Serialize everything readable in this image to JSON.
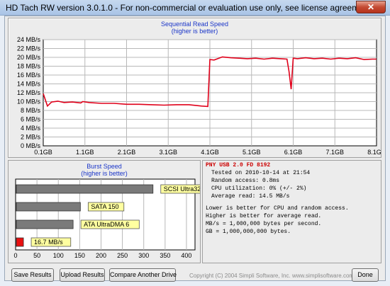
{
  "window": {
    "title": "HD Tach RW version 3.0.1.0  - For non-commercial or evaluation use only, see license agreement.",
    "close_label": "✕"
  },
  "read_chart": {
    "title": "Sequential Read Speed",
    "subtitle": "(higher is better)",
    "y_ticks": [
      "0 MB/s",
      "2 MB/s",
      "4 MB/s",
      "6 MB/s",
      "8 MB/s",
      "10 MB/s",
      "12 MB/s",
      "14 MB/s",
      "16 MB/s",
      "18 MB/s",
      "20 MB/s",
      "22 MB/s",
      "24 MB/s"
    ],
    "x_ticks": [
      "0.1GB",
      "1.1GB",
      "2.1GB",
      "3.1GB",
      "4.1GB",
      "5.1GB",
      "6.1GB",
      "7.1GB",
      "8.1GB"
    ],
    "line_color": "#e0001a"
  },
  "burst_chart": {
    "title": "Burst Speed",
    "subtitle": "(higher is better)",
    "x_ticks": [
      "0",
      "50",
      "100",
      "150",
      "200",
      "250",
      "300",
      "350",
      "400"
    ]
  },
  "chart_data": [
    {
      "type": "line",
      "title": "Sequential Read Speed",
      "subtitle": "(higher is better)",
      "xlabel": "",
      "ylabel": "",
      "x_unit": "GB",
      "y_unit": "MB/s",
      "xlim": [
        0.1,
        8.1
      ],
      "ylim": [
        0,
        24
      ],
      "grid": true,
      "series": [
        {
          "x": [
            0.1,
            0.2,
            0.3,
            0.45,
            0.6,
            0.8,
            1.0,
            1.05,
            1.2,
            1.5,
            1.8,
            2.1,
            2.4,
            2.7,
            3.0,
            3.3,
            3.6,
            3.9,
            4.05,
            4.1,
            4.2,
            4.4,
            4.6,
            4.8,
            5.0,
            5.2,
            5.4,
            5.6,
            5.8,
            5.95,
            6.0,
            6.05,
            6.1,
            6.2,
            6.4,
            6.6,
            6.8,
            7.0,
            7.2,
            7.4,
            7.6,
            7.8,
            8.0,
            8.1
          ],
          "y": [
            11.8,
            9.0,
            9.9,
            10.1,
            9.8,
            9.9,
            9.7,
            10.0,
            9.8,
            9.6,
            9.6,
            9.4,
            9.4,
            9.3,
            9.2,
            9.3,
            9.3,
            9.0,
            8.9,
            19.5,
            19.4,
            20.1,
            19.9,
            19.8,
            19.7,
            19.8,
            19.6,
            19.8,
            19.7,
            19.6,
            16.8,
            12.8,
            19.8,
            19.7,
            19.9,
            19.7,
            19.8,
            19.6,
            19.8,
            19.7,
            19.9,
            19.5,
            19.6,
            19.6
          ]
        }
      ]
    },
    {
      "type": "bar",
      "title": "Burst Speed",
      "subtitle": "(higher is better)",
      "xlim": [
        0,
        420
      ],
      "categories": [
        "SCSI Ultra320",
        "SATA 150",
        "ATA UltraDMA 6",
        "16.7 MB/s"
      ],
      "values": [
        320,
        150,
        133,
        16.7
      ],
      "colors": [
        "#7a7a7a",
        "#7a7a7a",
        "#7a7a7a",
        "#e81010"
      ]
    }
  ],
  "info": {
    "drive_name": "PNY USB 2.0 FD 8192",
    "details": [
      "Tested on 2010-10-14 at 21:54",
      "Random access: 0.8ms",
      "CPU utilization: 0% (+/- 2%)",
      "Average read: 14.5 MB/s"
    ],
    "notes": [
      "Lower is better for CPU and random access.",
      "Higher is better for average read.",
      "MB/s = 1,000,000 bytes per second.",
      "GB = 1,000,000,000 bytes."
    ]
  },
  "buttons": {
    "save": "Save Results",
    "upload": "Upload Results",
    "compare": "Compare Another Drive",
    "done": "Done"
  },
  "copyright": "Copyright (C) 2004 Simpli Software, Inc. www.simplisoftware.com"
}
